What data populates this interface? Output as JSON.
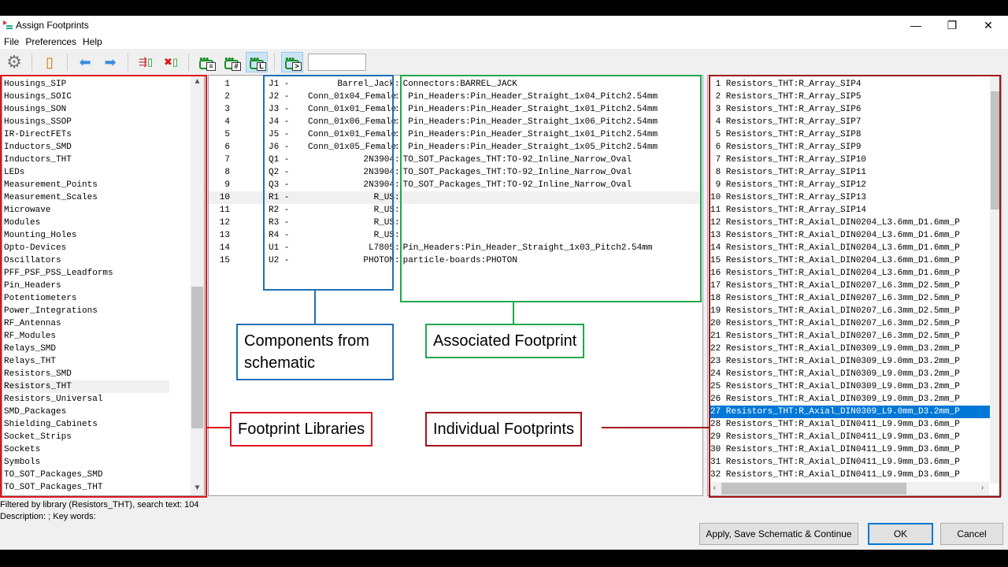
{
  "window": {
    "title": "Assign Footprints",
    "controls": {
      "minimize": "—",
      "restore": "❐",
      "close": "✕"
    }
  },
  "menu": [
    "File",
    "Preferences",
    "Help"
  ],
  "toolbar": {
    "icons": [
      "gear-icon",
      "footprint-viewer-icon",
      "arrow-left-icon",
      "arrow-right-icon",
      "auto-associate-icon",
      "delete-associations-icon",
      "filter-keywords-icon",
      "filter-pincount-icon",
      "filter-library-icon",
      "filter-text-icon"
    ],
    "filter_text": ""
  },
  "libraries": [
    "Housings_SIP",
    "Housings_SOIC",
    "Housings_SON",
    "Housings_SSOP",
    "IR-DirectFETs",
    "Inductors_SMD",
    "Inductors_THT",
    "LEDs",
    "Measurement_Points",
    "Measurement_Scales",
    "Microwave",
    "Modules",
    "Mounting_Holes",
    "Opto-Devices",
    "Oscillators",
    "PFF_PSF_PSS_Leadforms",
    "Pin_Headers",
    "Potentiometers",
    "Power_Integrations",
    "RF_Antennas",
    "RF_Modules",
    "Relays_SMD",
    "Relays_THT",
    "Resistors_SMD",
    "Resistors_THT",
    "Resistors_Universal",
    "SMD_Packages",
    "Shielding_Cabinets",
    "Socket_Strips",
    "Sockets",
    "Symbols",
    "TO_SOT_Packages_SMD",
    "TO_SOT_Packages_THT"
  ],
  "selected_library": "Resistors_THT",
  "components": [
    {
      "n": "1",
      "ref": "J1 -",
      "value": "Barrel_Jack",
      "fp": "Connectors:BARREL_JACK"
    },
    {
      "n": "2",
      "ref": "J2 -",
      "value": "Conn_01x04_Female",
      "fp": " Pin_Headers:Pin_Header_Straight_1x04_Pitch2.54mm"
    },
    {
      "n": "3",
      "ref": "J3 -",
      "value": "Conn_01x01_Female",
      "fp": " Pin_Headers:Pin_Header_Straight_1x01_Pitch2.54mm"
    },
    {
      "n": "4",
      "ref": "J4 -",
      "value": "Conn_01x06_Female",
      "fp": " Pin_Headers:Pin_Header_Straight_1x06_Pitch2.54mm"
    },
    {
      "n": "5",
      "ref": "J5 -",
      "value": "Conn_01x01_Female",
      "fp": " Pin_Headers:Pin_Header_Straight_1x01_Pitch2.54mm"
    },
    {
      "n": "6",
      "ref": "J6 -",
      "value": "Conn_01x05_Female",
      "fp": " Pin_Headers:Pin_Header_Straight_1x05_Pitch2.54mm"
    },
    {
      "n": "7",
      "ref": "Q1 -",
      "value": "2N3904",
      "fp": "TO_SOT_Packages_THT:TO-92_Inline_Narrow_Oval"
    },
    {
      "n": "8",
      "ref": "Q2 -",
      "value": "2N3904",
      "fp": "TO_SOT_Packages_THT:TO-92_Inline_Narrow_Oval"
    },
    {
      "n": "9",
      "ref": "Q3 -",
      "value": "2N3904",
      "fp": "TO_SOT_Packages_THT:TO-92_Inline_Narrow_Oval"
    },
    {
      "n": "10",
      "ref": "R1 -",
      "value": "R_US",
      "fp": ""
    },
    {
      "n": "11",
      "ref": "R2 -",
      "value": "R_US",
      "fp": ""
    },
    {
      "n": "12",
      "ref": "R3 -",
      "value": "R_US",
      "fp": ""
    },
    {
      "n": "13",
      "ref": "R4 -",
      "value": "R_US",
      "fp": ""
    },
    {
      "n": "14",
      "ref": "U1 -",
      "value": "L7805",
      "fp": "Pin_Headers:Pin_Header_Straight_1x03_Pitch2.54mm"
    },
    {
      "n": "15",
      "ref": "U2 -",
      "value": "PHOTON",
      "fp": "particle-boards:PHOTON"
    }
  ],
  "selected_component": "10",
  "footprints": [
    " 1 Resistors_THT:R_Array_SIP4",
    " 2 Resistors_THT:R_Array_SIP5",
    " 3 Resistors_THT:R_Array_SIP6",
    " 4 Resistors_THT:R_Array_SIP7",
    " 5 Resistors_THT:R_Array_SIP8",
    " 6 Resistors_THT:R_Array_SIP9",
    " 7 Resistors_THT:R_Array_SIP10",
    " 8 Resistors_THT:R_Array_SIP11",
    " 9 Resistors_THT:R_Array_SIP12",
    "10 Resistors_THT:R_Array_SIP13",
    "11 Resistors_THT:R_Array_SIP14",
    "12 Resistors_THT:R_Axial_DIN0204_L3.6mm_D1.6mm_P",
    "13 Resistors_THT:R_Axial_DIN0204_L3.6mm_D1.6mm_P",
    "14 Resistors_THT:R_Axial_DIN0204_L3.6mm_D1.6mm_P",
    "15 Resistors_THT:R_Axial_DIN0204_L3.6mm_D1.6mm_P",
    "16 Resistors_THT:R_Axial_DIN0204_L3.6mm_D1.6mm_P",
    "17 Resistors_THT:R_Axial_DIN0207_L6.3mm_D2.5mm_P",
    "18 Resistors_THT:R_Axial_DIN0207_L6.3mm_D2.5mm_P",
    "19 Resistors_THT:R_Axial_DIN0207_L6.3mm_D2.5mm_P",
    "20 Resistors_THT:R_Axial_DIN0207_L6.3mm_D2.5mm_P",
    "21 Resistors_THT:R_Axial_DIN0207_L6.3mm_D2.5mm_P",
    "22 Resistors_THT:R_Axial_DIN0309_L9.0mm_D3.2mm_P",
    "23 Resistors_THT:R_Axial_DIN0309_L9.0mm_D3.2mm_P",
    "24 Resistors_THT:R_Axial_DIN0309_L9.0mm_D3.2mm_P",
    "25 Resistors_THT:R_Axial_DIN0309_L9.0mm_D3.2mm_P",
    "26 Resistors_THT:R_Axial_DIN0309_L9.0mm_D3.2mm_P",
    "27 Resistors_THT:R_Axial_DIN0309_L9.0mm_D3.2mm_P",
    "28 Resistors_THT:R_Axial_DIN0411_L9.9mm_D3.6mm_P",
    "29 Resistors_THT:R_Axial_DIN0411_L9.9mm_D3.6mm_P",
    "30 Resistors_THT:R_Axial_DIN0411_L9.9mm_D3.6mm_P",
    "31 Resistors_THT:R_Axial_DIN0411_L9.9mm_D3.6mm_P",
    "32 Resistors_THT:R_Axial_DIN0411_L9.9mm_D3.6mm_P"
  ],
  "selected_footprint": "27",
  "status": {
    "line1": "Filtered by library (Resistors_THT), search text: 104",
    "line2": "Description: ;  Key words:"
  },
  "buttons": {
    "apply": "Apply, Save Schematic & Continue",
    "ok": "OK",
    "cancel": "Cancel"
  },
  "annotations": {
    "components": "Components from schematic",
    "associated": "Associated Footprint",
    "libraries": "Footprint Libraries",
    "individual": "Individual Footprints"
  },
  "colors": {
    "red": "#e0141e",
    "blue": "#1f6fb5",
    "green": "#1fa84f",
    "darkred": "#a5121a",
    "selection": "#0078d7"
  }
}
